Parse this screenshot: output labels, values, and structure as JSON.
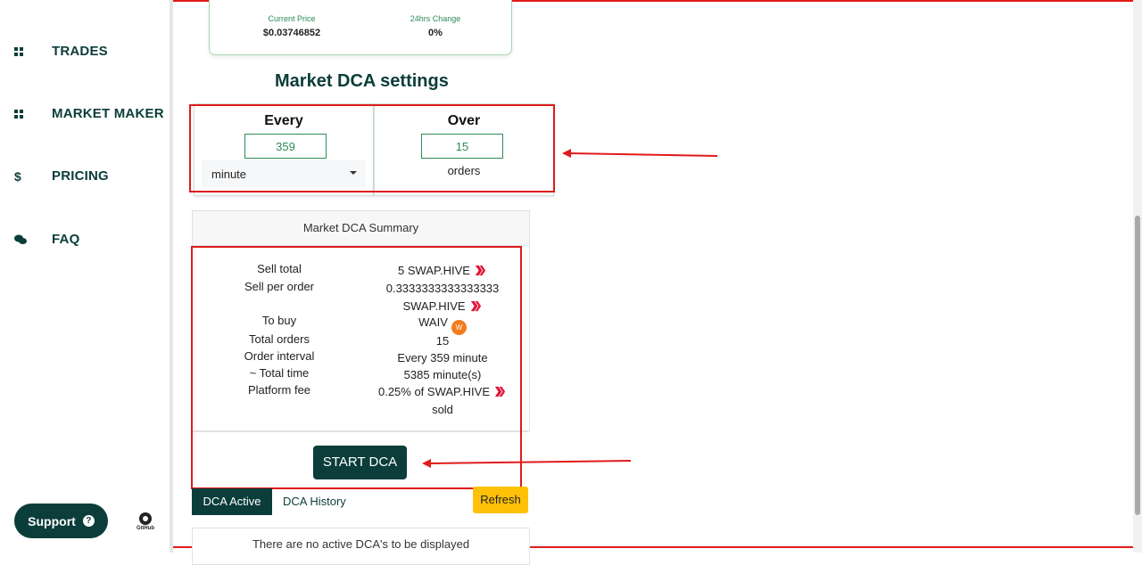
{
  "sidebar": {
    "items": [
      {
        "label": "TRADES",
        "icon": "grid-icon"
      },
      {
        "label": "MARKET MAKER",
        "icon": "grid-icon"
      },
      {
        "label": "PRICING",
        "icon": "dollar-icon"
      },
      {
        "label": "FAQ",
        "icon": "chat-icon"
      }
    ],
    "support_label": "Support",
    "github_label": "GitHub"
  },
  "price": {
    "current_label": "Current Price",
    "current_value": "$0.03746852",
    "change_label": "24hrs Change",
    "change_value": "0%"
  },
  "dca": {
    "title": "Market DCA settings",
    "every": {
      "title": "Every",
      "value": "359",
      "unit": "minute"
    },
    "over": {
      "title": "Over",
      "value": "15",
      "unit": "orders"
    }
  },
  "summary": {
    "title": "Market DCA Summary",
    "sell_total_label": "Sell total",
    "sell_total_value": "5 SWAP.HIVE",
    "sell_per_order_label": "Sell per order",
    "sell_per_order_value": "0.3333333333333333",
    "sell_per_order_token": "SWAP.HIVE",
    "to_buy_label": "To buy",
    "to_buy_value": "WAIV",
    "total_orders_label": "Total orders",
    "total_orders_value": "15",
    "order_interval_label": "Order interval",
    "order_interval_value": "Every 359 minute",
    "total_time_label": "~ Total time",
    "total_time_value": "5385 minute(s)",
    "platform_fee_label": "Platform fee",
    "platform_fee_value": "0.25% of SWAP.HIVE",
    "platform_fee_suffix": "sold"
  },
  "start_label": "START DCA",
  "tabs": {
    "active": "DCA Active",
    "history": "DCA History"
  },
  "refresh_label": "Refresh",
  "empty_message": "There are no active DCA's to be displayed",
  "colors": {
    "brand": "#0b3d3a",
    "accent_green": "#2e8b57",
    "highlight_red": "#e01b1b",
    "refresh_yellow": "#ffc107"
  }
}
